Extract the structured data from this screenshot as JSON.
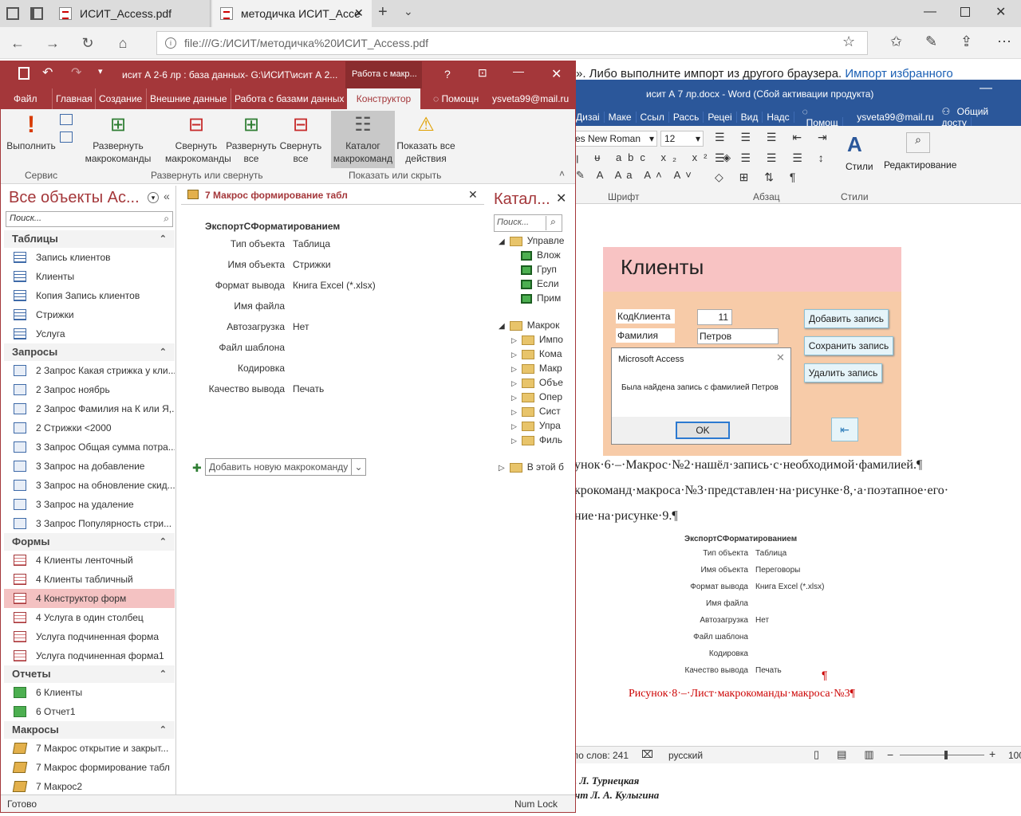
{
  "browser": {
    "tabs": [
      {
        "label": "ИСИТ_Access.pdf"
      },
      {
        "label": "методичка ИСИТ_Acce"
      }
    ],
    "url": "file:///G:/ИСИТ/методичка%20ИСИТ_Access.pdf",
    "pdf_text": "». Либо выполните импорт из другого браузера.",
    "pdf_link": "Импорт избранного"
  },
  "word": {
    "title": "исит А 7 лр.docx - Word (Сбой активации продукта)",
    "tabs": [
      "Дизаі",
      "Маке",
      "Ссыл",
      "Рассь",
      "Рецеі",
      "Вид",
      "Надс"
    ],
    "help": "Помощ",
    "user": "ysveta99@mail.ru",
    "share": "Общий досту",
    "font_name": "es New Roman",
    "font_size": "12",
    "group_font": "Шрифт",
    "group_para": "Абзац",
    "group_styles": "Стили",
    "styles_btn": "Стили",
    "edit_btn": "Редактирование",
    "line1": "унок·6·–·Макрос·№2·нашёл·запись·с·необходимой·фамилией.¶",
    "line2": "крокоманд·макроса·№3·представлен·на·рисунке·8,·а·поэтапное·его·",
    "line3": "ние·на·рисунке·9.¶",
    "figure": {
      "header": "ЭкспортСФорматированием",
      "rows": [
        {
          "label": "Тип объекта",
          "value": "Таблица"
        },
        {
          "label": "Имя объекта",
          "value": "Переговоры"
        },
        {
          "label": "Формат вывода",
          "value": "Книга Excel (*.xlsx)"
        },
        {
          "label": "Имя файла",
          "value": ""
        },
        {
          "label": "Автозагрузка",
          "value": "Нет"
        },
        {
          "label": "Файл шаблона",
          "value": ""
        },
        {
          "label": "Кодировка",
          "value": ""
        },
        {
          "label": "Качество вывода",
          "value": "Печать"
        }
      ],
      "pilcrow": "¶"
    },
    "caption": "Рисунок·8·–·Лист·макрокоманды·макроса·№3¶",
    "status_words": "ло слов: 241",
    "status_lang": "русский",
    "status_zoom": "100",
    "footer1": ". Л. Турнецкая",
    "footer2": "нт Л. А. Кулыгина"
  },
  "clients_form": {
    "title": "Клиенты",
    "field1_label": "КодКлиента",
    "field1_value": "11",
    "field2_label": "Фамилия",
    "field2_value": "Петров",
    "btn_add": "Добавить запись",
    "btn_save": "Сохранить запись",
    "btn_delete": "Удалить запись"
  },
  "dialog": {
    "title": "Microsoft Access",
    "message": "Была найдена запись с фамилией Петров",
    "ok": "OK"
  },
  "access": {
    "title": "исит А 2-6 лр : база данных- G:\\ИСИТ\\исит А 2...",
    "context_tab": "Работа с макр...",
    "help_q": "?",
    "menu": [
      "Файл",
      "Главная",
      "Создание",
      "Внешние данные",
      "Работа с базами данных",
      "Конструктор"
    ],
    "help": "Помощн",
    "user": "ysveta99@mail.ru",
    "ribbon": {
      "run": "Выполнить",
      "expand_actions": "Развернуть макрокоманды",
      "collapse_actions": "Свернуть макрокоманды",
      "expand_all": "Развернуть все",
      "collapse_all": "Свернуть все",
      "catalog": "Каталог макрокоманд",
      "show_all": "Показать все действия",
      "group_service": "Сервис",
      "group_expand": "Развернуть или свернуть",
      "group_show": "Показать или скрыть"
    },
    "nav": {
      "title": "Все объекты Ac...",
      "search_placeholder": "Поиск...",
      "groups": [
        {
          "name": "Таблицы",
          "kind": "tbl",
          "items": [
            "Запись клиентов",
            "Клиенты",
            "Копия Запись клиентов",
            "Стрижки",
            "Услуга"
          ]
        },
        {
          "name": "Запросы",
          "kind": "qry",
          "items": [
            "2 Запрос Какая стрижка у кли...",
            "2 Запрос ноябрь",
            "2 Запрос Фамилия на К или Я,...",
            "2 Стрижки <2000",
            "3 Запрос Общая сумма потра...",
            "3 Запрос на добавление",
            "3 Запрос на обновление скид...",
            "3 Запрос на удаление",
            "3 Запрос Популярность стри..."
          ]
        },
        {
          "name": "Формы",
          "kind": "frm",
          "items": [
            "4 Клиенты ленточный",
            "4 Клиенты табличный",
            "4 Конструктор форм",
            "4 Услуга в один столбец",
            "Услуга подчиненная форма",
            "Услуга подчиненная форма1"
          ]
        },
        {
          "name": "Отчеты",
          "kind": "rpt",
          "items": [
            "6 Клиенты",
            "6 Отчет1"
          ]
        },
        {
          "name": "Макросы",
          "kind": "mac",
          "items": [
            "7 Макрос открытие и закрыт...",
            "7 Макрос формирование табл",
            "7 Макрос2"
          ]
        }
      ],
      "selected": "4 Конструктор форм"
    },
    "doc": {
      "tab_label": "7 Макрос формирование табл",
      "action": "ЭкспортСФорматированием",
      "rows": [
        {
          "label": "Тип объекта",
          "value": "Таблица"
        },
        {
          "label": "Имя объекта",
          "value": "Стрижки"
        },
        {
          "label": "Формат вывода",
          "value": "Книга Excel (*.xlsx)"
        },
        {
          "label": "Имя файла",
          "value": ""
        },
        {
          "label": "Автозагрузка",
          "value": "Нет"
        },
        {
          "label": "Файл шаблона",
          "value": ""
        },
        {
          "label": "Кодировка",
          "value": ""
        },
        {
          "label": "Качество вывода",
          "value": "Печать"
        }
      ],
      "add_new": "Добавить новую макрокоманду"
    },
    "catalog": {
      "title": "Катал...",
      "search_placeholder": "Поиск...",
      "sections": [
        {
          "name": "Управле",
          "items": [
            "Влож",
            "Груп",
            "Если",
            "Прим"
          ]
        },
        {
          "name": "Макрок",
          "items": [
            "Импо",
            "Кома",
            "Макр",
            "Объе",
            "Опер",
            "Сист",
            "Упра",
            "Филь"
          ]
        },
        {
          "name": "В этой б",
          "items": []
        }
      ]
    },
    "status_left": "Готово",
    "status_right": "Num Lock"
  }
}
